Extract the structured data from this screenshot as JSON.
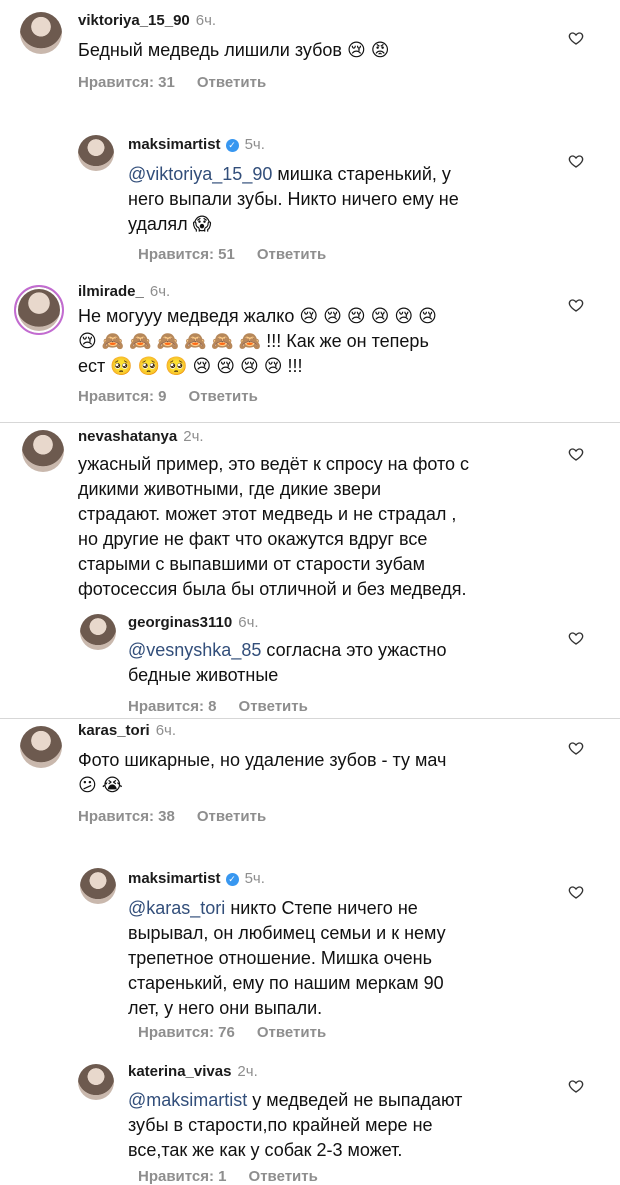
{
  "comments": [
    {
      "user": "viktoriya_15_90",
      "time": "6ч.",
      "verified": false,
      "text": "Бедный медведь лишили зубов 😢 😡",
      "likes": "Нравится: 31",
      "reply": "Ответить"
    },
    {
      "user": "maksimartist",
      "time": "5ч.",
      "verified": true,
      "mention": "@viktoriya_15_90",
      "text": " мишка старенький, у\nнего выпали зубы. Никто ничего ему не\nудалял 😱",
      "likes": "Нравится: 51",
      "reply": "Ответить"
    },
    {
      "user": "ilmirade_",
      "time": "6ч.",
      "verified": false,
      "text": "Не могууу медведя жалко 😢 😢 😢 😢 😢 😢\n😢 🙈 🙈 🙈 🙈 🙈 🙈 !!! Как же он теперь\nест 🥺 🥺 🥺 😢 😢 😢 😢 !!!",
      "likes": "Нравится: 9",
      "reply": "Ответить"
    },
    {
      "user": "nevashatanya",
      "time": "2ч.",
      "verified": false,
      "text": "ужасный пример, это ведёт к спросу на фото с\nдикими животными, где дикие звери\nстрадают. может этот медведь и не страдал ,\nно другие не факт что окажутся вдруг все\nстарыми с выпавшими от старости зубам\nфотосессия была бы отличной и без медведя.",
      "likes": "",
      "reply": ""
    },
    {
      "user": "georginas3110",
      "time": "6ч.",
      "verified": false,
      "mention": "@vesnyshka_85",
      "text": " согласна это ужастно\nбедные животные",
      "likes": "Нравится: 8",
      "reply": "Ответить"
    },
    {
      "user": "karas_tori",
      "time": "6ч.",
      "verified": false,
      "text": "Фото шикарные, но удаление зубов - ту мач\n😕 😭",
      "likes": "Нравится: 38",
      "reply": "Ответить"
    },
    {
      "user": "maksimartist",
      "time": "5ч.",
      "verified": true,
      "mention": "@karas_tori",
      "text": " никто Степе ничего не\nвырывал, он любимец семьи и к нему\nтрепетное отношение. Мишка очень\nстаренький, ему по нашим меркам 90\nлет, у него они выпали.",
      "likes": "Нравится: 76",
      "reply": "Ответить"
    },
    {
      "user": "katerina_vivas",
      "time": "2ч.",
      "verified": false,
      "mention": "@maksimartist",
      "text": " у медведей не выпадают\nзубы в старости,по крайней мере не\nвсе,так же как у собак 2-3 может.",
      "likes": "Нравится: 1",
      "reply": "Ответить"
    }
  ],
  "icons": {
    "like": "heart-outline-icon",
    "verified": "verified-badge-icon"
  },
  "colors": {
    "mention": "#324e7a",
    "meta": "#8e8e8e",
    "verified": "#3897f0"
  }
}
